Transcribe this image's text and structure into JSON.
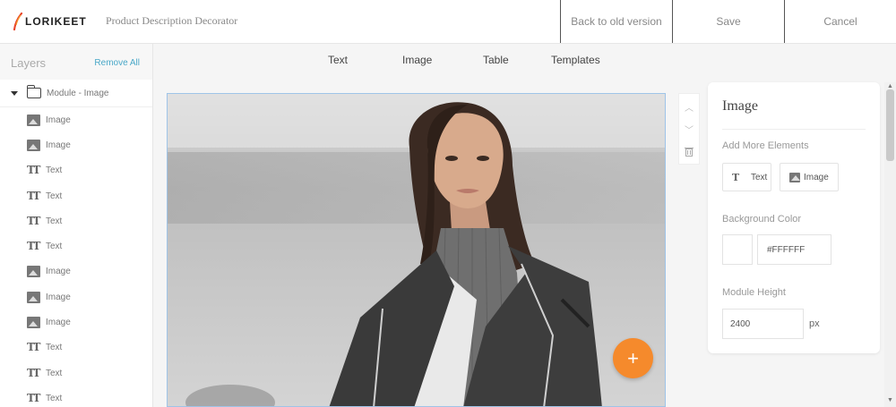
{
  "header": {
    "logo_text": "LORIKEET",
    "app_title": "Product Description Decorator",
    "back_label": "Back to old version",
    "save_label": "Save",
    "cancel_label": "Cancel"
  },
  "layers": {
    "title": "Layers",
    "remove_all": "Remove All",
    "module_label": "Module - Image",
    "items": [
      {
        "type": "image-icon",
        "label": "Image"
      },
      {
        "type": "image-icon",
        "label": "Image"
      },
      {
        "type": "text-icon",
        "label": "Text"
      },
      {
        "type": "text-icon",
        "label": "Text"
      },
      {
        "type": "text-icon",
        "label": "Text"
      },
      {
        "type": "text-icon",
        "label": "Text"
      },
      {
        "type": "image-icon",
        "label": "Image"
      },
      {
        "type": "image-icon",
        "label": "Image"
      },
      {
        "type": "image-icon",
        "label": "Image"
      },
      {
        "type": "text-icon",
        "label": "Text"
      },
      {
        "type": "text-icon",
        "label": "Text"
      },
      {
        "type": "text-icon",
        "label": "Text"
      }
    ]
  },
  "toolbar": {
    "text": "Text",
    "image": "Image",
    "table": "Table",
    "templates": "Templates"
  },
  "canvas": {
    "fab_label": "+"
  },
  "properties": {
    "title": "Image",
    "add_more_label": "Add More Elements",
    "add_text": "Text",
    "add_image": "Image",
    "bg_color_label": "Background Color",
    "bg_color_value": "#FFFFFF",
    "module_height_label": "Module Height",
    "module_height_value": "2400",
    "unit": "px"
  },
  "colors": {
    "accent": "#f58a2c",
    "link": "#4aa8c8",
    "selection_border": "#9fc4e8"
  }
}
